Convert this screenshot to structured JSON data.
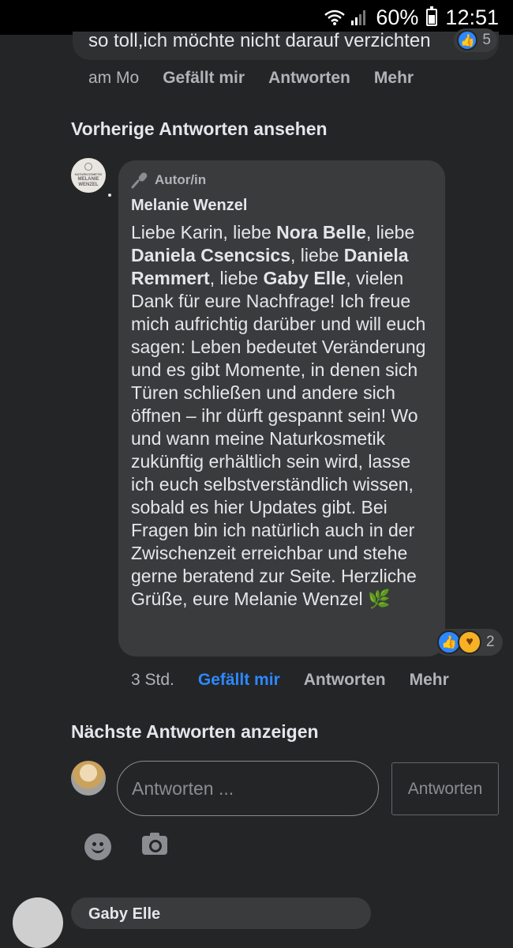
{
  "status_bar": {
    "battery": "60%",
    "time": "12:51"
  },
  "previous_comment": {
    "text_tail": "so toll,ich möchte nicht darauf verzichten",
    "reaction_count": "5",
    "time": "am Mo",
    "like_label": "Gefällt mir",
    "reply_label": "Antworten",
    "more_label": "Mehr"
  },
  "view_previous_replies": "Vorherige Antworten ansehen",
  "reply": {
    "author_badge": "Autor/in",
    "author_name": "Melanie Wenzel",
    "avatar_text_top": "NATURKOSMETIK",
    "avatar_text_name1": "MELANIE",
    "avatar_text_name2": "WENZEL",
    "segments": {
      "s1": "Liebe Karin, liebe ",
      "n1": "Nora Belle",
      "s2": ", liebe ",
      "n2": "Daniela Csencsics",
      "s3": ", liebe ",
      "n3": "Daniela Remmert",
      "s4": ", liebe ",
      "n4": "Gaby Elle",
      "s5": ", vielen Dank für eure Nachfrage! Ich freue mich aufrichtig darüber und will euch sagen: Leben bedeutet Veränderung und es gibt Momente, in denen sich Türen schließen und andere sich öffnen – ihr dürft gespannt sein! Wo und wann meine Naturkosmetik zukünftig erhältlich sein wird, lasse ich euch selbstverständlich wissen, sobald es hier Updates gibt. Bei Fragen bin ich natürlich auch in der Zwischenzeit erreichbar und stehe gerne beratend zur Seite. Herzliche Grüße, eure Melanie Wenzel ",
      "emoji": "🌿"
    },
    "reaction_count": "2",
    "time": "3 Std.",
    "like_label": "Gefällt mir",
    "reply_label": "Antworten",
    "more_label": "Mehr"
  },
  "view_next_replies": "Nächste Antworten anzeigen",
  "composer": {
    "placeholder": "Antworten ...",
    "submit_label": "Antworten"
  },
  "next_comment_author": "Gaby Elle",
  "colors": {
    "background": "#242526",
    "bubble": "#3a3b3c",
    "link_blue": "#2d88ff"
  }
}
